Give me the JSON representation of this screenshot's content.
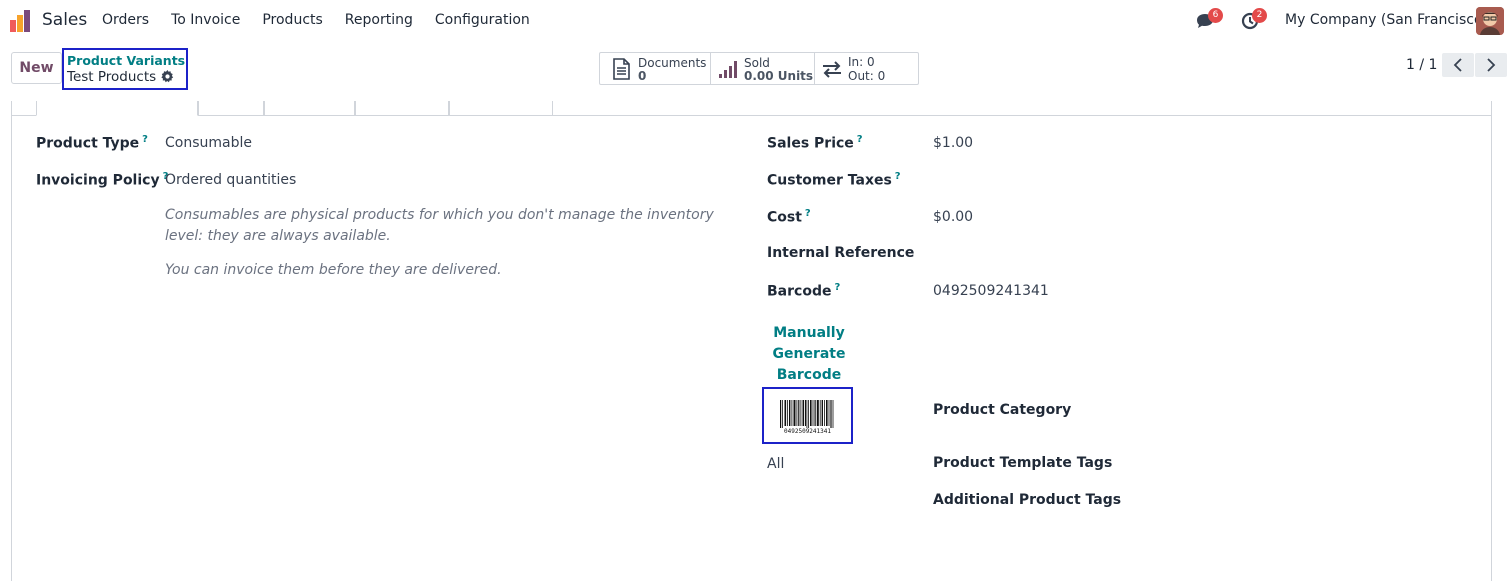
{
  "navbar": {
    "app_name": "Sales",
    "menu": [
      "Orders",
      "To Invoice",
      "Products",
      "Reporting",
      "Configuration"
    ],
    "messages_badge": "6",
    "activities_badge": "2",
    "company": "My Company (San Francisco)"
  },
  "control_panel": {
    "new_label": "New",
    "breadcrumb_parent": "Product Variants",
    "breadcrumb_current": "Test Products",
    "smart_buttons": {
      "documents": {
        "label": "Documents",
        "value": "0"
      },
      "sold": {
        "label": "Sold",
        "value": "0.00 Units"
      },
      "moves": {
        "in": "In: 0",
        "out": "Out: 0"
      }
    },
    "pager": "1 / 1"
  },
  "form": {
    "product_type": {
      "label": "Product Type",
      "help_mark": "?",
      "value": "Consumable"
    },
    "invoicing_policy": {
      "label": "Invoicing Policy",
      "help_mark": "?",
      "value": "Ordered quantities"
    },
    "help_text_1": "Consumables are physical products for which you don't manage the inventory level: they are always available.",
    "help_text_2": "You can invoice them before they are delivered.",
    "sales_price": {
      "label": "Sales Price",
      "help_mark": "?",
      "value": "$1.00"
    },
    "customer_taxes": {
      "label": "Customer Taxes",
      "help_mark": "?"
    },
    "cost": {
      "label": "Cost",
      "help_mark": "?",
      "value": "$0.00"
    },
    "internal_reference": {
      "label": "Internal Reference"
    },
    "barcode": {
      "label": "Barcode",
      "help_mark": "?",
      "value": "0492509241341"
    },
    "generate_barcode_label": "Manually Generate Barcode",
    "barcode_image_text": "0492509241341",
    "category_value": "All",
    "product_category_label": "Product Category",
    "product_template_tags_label": "Product Template Tags",
    "additional_product_tags_label": "Additional Product Tags"
  },
  "colors": {
    "accent": "#017e84",
    "brand": "#714b67",
    "badge": "#e34a4a",
    "highlight": "#1c22c8"
  }
}
